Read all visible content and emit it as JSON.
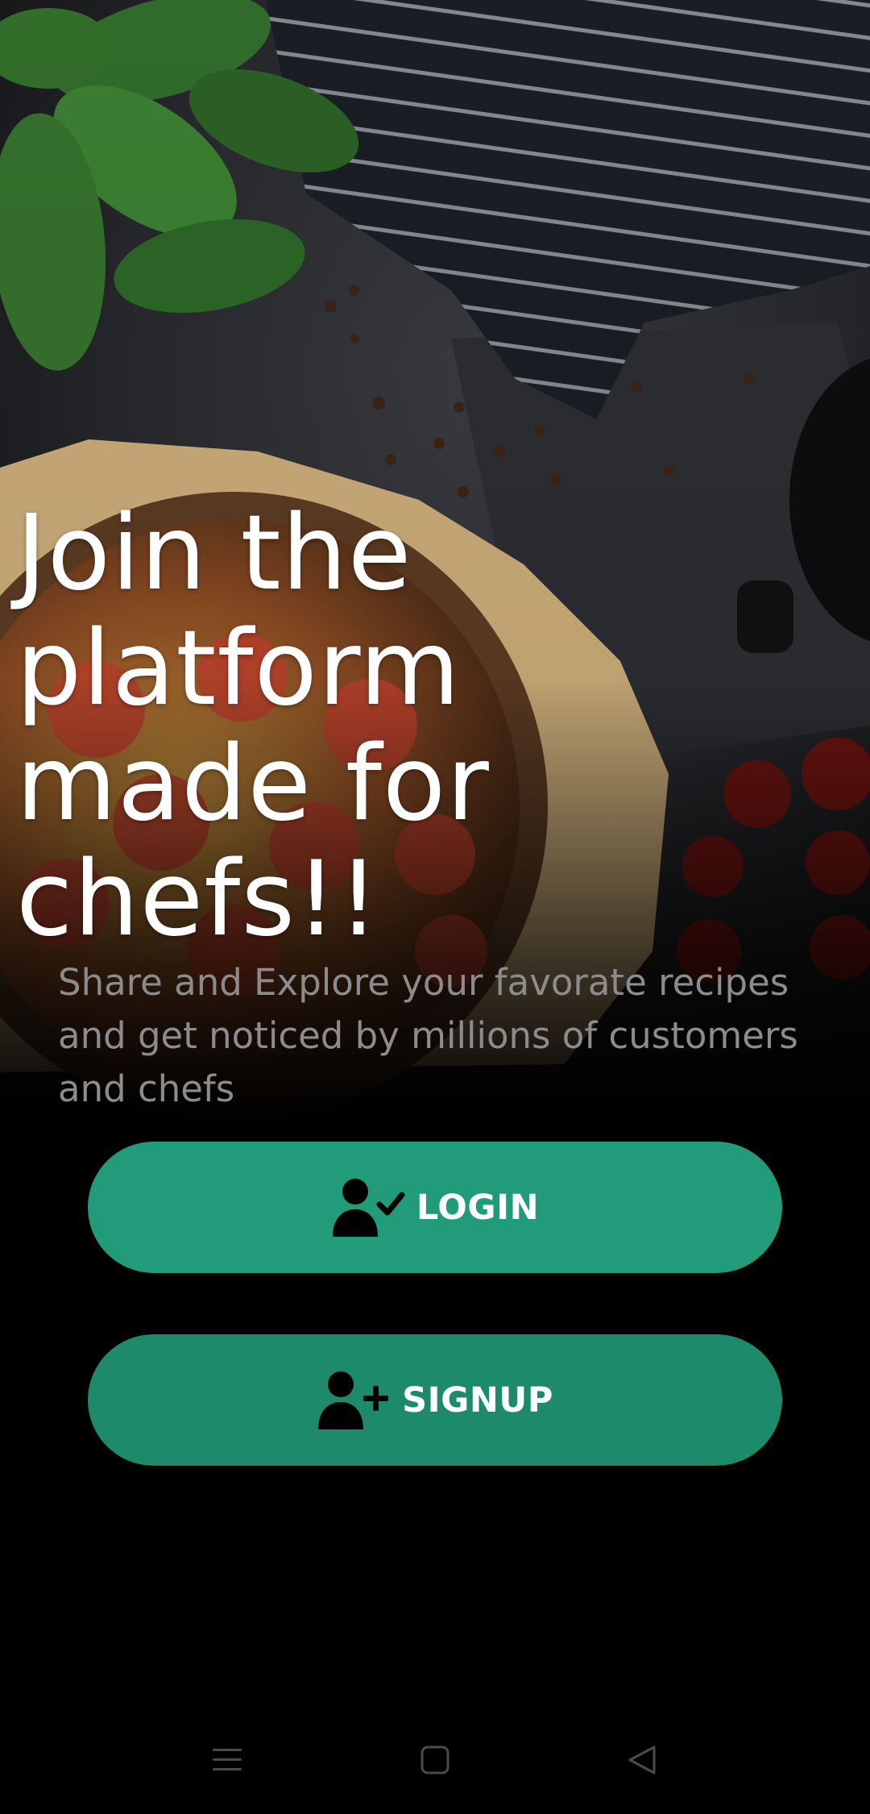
{
  "hero": {
    "headline": [
      "Join the",
      "platform",
      "made for",
      "chefs!!"
    ],
    "subtitle": "Share and Explore your favorate recipes and get noticed by millions of customers and chefs"
  },
  "buttons": {
    "login_label": "LOGIN",
    "signup_label": "SIGNUP",
    "color_login": "#229b7a",
    "color_signup": "#1d8a6c"
  },
  "icons": {
    "login": "user-check-icon",
    "signup": "user-plus-icon",
    "nav_menu": "menu-lines-icon",
    "nav_home": "home-square-icon",
    "nav_back": "back-triangle-icon"
  }
}
